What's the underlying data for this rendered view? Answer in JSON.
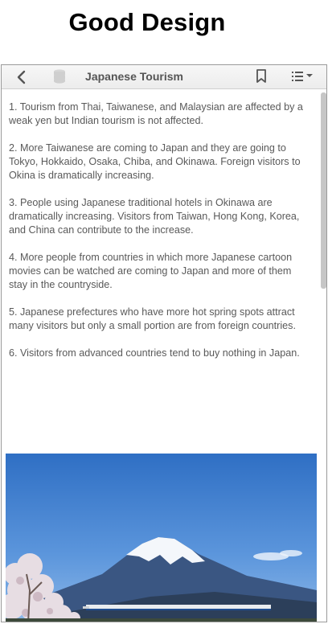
{
  "page": {
    "headline": "Good Design"
  },
  "toolbar": {
    "title": "Japanese Tourism",
    "icons": {
      "back": "chevron-left-icon",
      "database": "database-icon",
      "bookmark": "bookmark-icon",
      "menu": "list-menu-icon"
    }
  },
  "content": {
    "items": [
      "1. Tourism from Thai, Taiwanese, and Malaysian are affected by a weak yen but Indian tourism is not affected.",
      "2. More Taiwanese are coming to Japan and they are going to Tokyo, Hokkaido, Osaka, Chiba, and Okinawa. Foreign visitors to Okina is dramatically increasing.",
      "3. People using Japanese traditional hotels in Okinawa are dramatically increasing. Visitors from Taiwan, Hong Kong, Korea, and China can contribute to the increase.",
      "4. More people from countries in which more Japanese cartoon movies can be watched are coming to Japan and more of them stay in the countryside.",
      "5. Japanese prefectures who have more hot spring spots attract many visitors but only a small portion are from foreign countries.",
      "6. Visitors from advanced countries tend to buy nothing in Japan."
    ]
  },
  "colors": {
    "sky": "#3f7fcf",
    "mountain": "#34507a",
    "text": "#595959"
  }
}
